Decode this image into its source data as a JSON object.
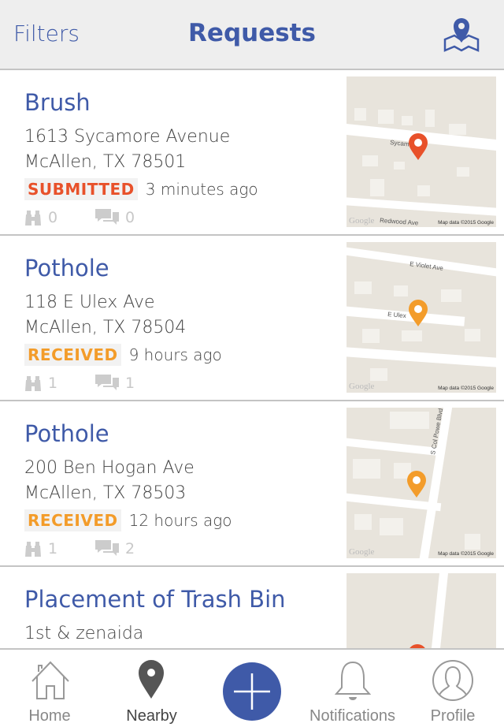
{
  "header": {
    "filters_label": "Filters",
    "title": "Requests",
    "map_icon": "map-pin-icon"
  },
  "requests": [
    {
      "title": "Brush",
      "address_line1": "1613 Sycamore Avenue",
      "address_line2": "McAllen, TX 78501",
      "status": "SUBMITTED",
      "status_color": "#e8512a",
      "time": "3 minutes ago",
      "follows": "0",
      "comments": "0",
      "map": {
        "streets": [
          "Sycam",
          "Redwood Ave"
        ],
        "logo": "Google",
        "attribution": "Map data ©2015 Google",
        "pin_color": "#e8512a"
      }
    },
    {
      "title": "Pothole",
      "address_line1": "118 E Ulex Ave",
      "address_line2": "McAllen, TX 78504",
      "status": "RECEIVED",
      "status_color": "#f39c2a",
      "time": "9 hours ago",
      "follows": "1",
      "comments": "1",
      "map": {
        "streets": [
          "E Violet Ave",
          "E Ulex"
        ],
        "logo": "Google",
        "attribution": "Map data ©2015 Google",
        "pin_color": "#f39c2a"
      }
    },
    {
      "title": "Pothole",
      "address_line1": "200 Ben Hogan Ave",
      "address_line2": "McAllen, TX 78503",
      "status": "RECEIVED",
      "status_color": "#f39c2a",
      "time": "12 hours ago",
      "follows": "1",
      "comments": "2",
      "map": {
        "streets": [
          "S Col Powe Blvd"
        ],
        "logo": "Google",
        "attribution": "Map data ©2015 Google",
        "pin_color": "#f39c2a"
      }
    },
    {
      "title": "Placement of Trash Bin",
      "address_line1": "1st & zenaida",
      "map": {
        "pin_color": "#e8512a"
      }
    }
  ],
  "tabbar": {
    "items": [
      {
        "label": "Home",
        "icon": "home-icon"
      },
      {
        "label": "Nearby",
        "icon": "location-pin-icon",
        "active": true
      },
      {
        "label": "",
        "icon": "plus-icon"
      },
      {
        "label": "Notifications",
        "icon": "bell-icon"
      },
      {
        "label": "Profile",
        "icon": "user-icon"
      }
    ]
  },
  "colors": {
    "accent": "#3f5aa8",
    "header_bg": "#eeeeee"
  }
}
